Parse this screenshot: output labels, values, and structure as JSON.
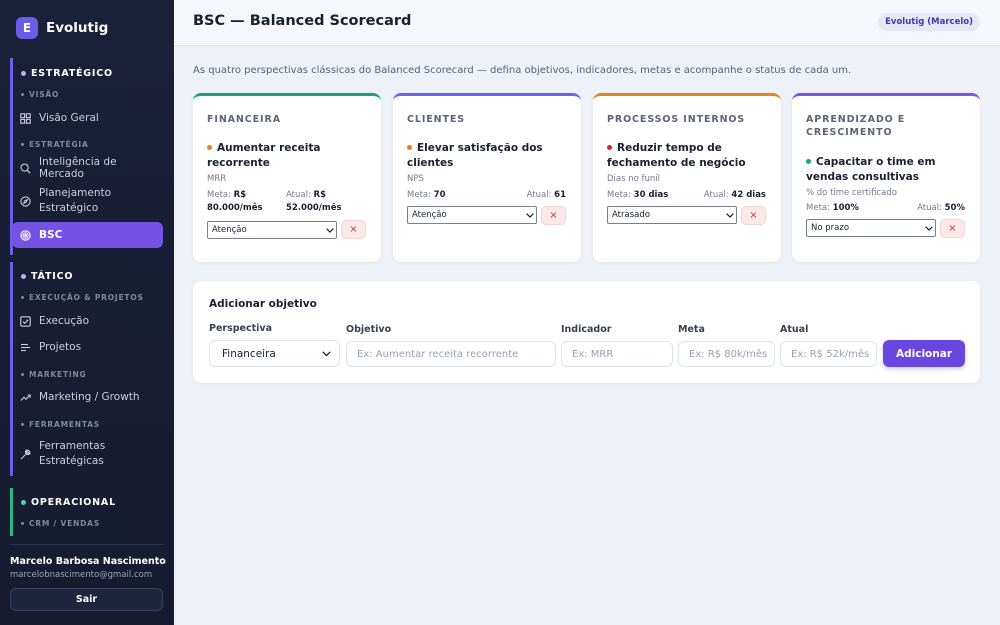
{
  "brand": {
    "logo_letter": "E",
    "name": "Evolutig"
  },
  "sidebar": {
    "sections": [
      {
        "label": "ESTRATÉGICO",
        "color": "#7c6cf0"
      },
      {
        "label": "TÁTICO",
        "color": "#7c6cf0"
      },
      {
        "label": "OPERACIONAL",
        "color": "#2bb57f"
      }
    ],
    "subs": [
      "VISÃO",
      "ESTRATÉGIA",
      "EXECUÇÃO & PROJETOS",
      "MARKETING",
      "FERRAMENTAS",
      "CRM / VENDAS"
    ],
    "items": [
      {
        "label": "Visão Geral",
        "icon": "grid-icon"
      },
      {
        "label": "Inteligência de Mercado",
        "icon": "search-icon"
      },
      {
        "label": "Planejamento Estratégico",
        "icon": "compass-icon"
      },
      {
        "label": "BSC",
        "icon": "target-icon",
        "active": true
      },
      {
        "label": "Execução",
        "icon": "checkbox-icon"
      },
      {
        "label": "Projetos",
        "icon": "list-icon"
      },
      {
        "label": "Marketing / Growth",
        "icon": "trend-icon"
      },
      {
        "label": "Ferramentas Estratégicas",
        "icon": "wrench-icon"
      }
    ],
    "user": {
      "name": "Marcelo Barbosa Nascimento",
      "email": "marcelobnascimento@gmail.com"
    },
    "logout_label": "Sair"
  },
  "header": {
    "title": "BSC — Balanced Scorecard",
    "user_badge": "Evolutig (Marcelo)"
  },
  "description": "As quatro perspectivas clássicas do Balanced Scorecard — defina objetivos, indicadores, metas e acompanhe o status de cada um.",
  "cards": [
    {
      "title": "FINANCEIRA",
      "color": "#1aa07a",
      "objective": "Aumentar receita recorrente",
      "dot": "#f07a1a",
      "indicator": "MRR",
      "meta_label": "Meta:",
      "meta": "R$ 80.000/mês",
      "atual_label": "Atual:",
      "atual": "R$ 52.000/mês",
      "status": "Atenção",
      "delete": "×"
    },
    {
      "title": "CLIENTES",
      "color": "#6d63f0",
      "objective": "Elevar satisfação dos clientes",
      "dot": "#f07a1a",
      "indicator": "NPS",
      "meta_label": "Meta:",
      "meta": "70",
      "atual_label": "Atual:",
      "atual": "61",
      "status": "Atenção",
      "delete": "×"
    },
    {
      "title": "PROCESSOS INTERNOS",
      "color": "#e0891a",
      "objective": "Reduzir tempo de fechamento de negócio",
      "dot": "#d9253a",
      "indicator": "Dias no funil",
      "meta_label": "Meta:",
      "meta": "30 dias",
      "atual_label": "Atual:",
      "atual": "42 dias",
      "status": "Atrasado",
      "delete": "×"
    },
    {
      "title": "APRENDIZADO E CRESCIMENTO",
      "color": "#7c55e8",
      "objective": "Capacitar o time em vendas consultivas",
      "dot": "#1aa07a",
      "indicator": "% do time certificado",
      "meta_label": "Meta:",
      "meta": "100%",
      "atual_label": "Atual:",
      "atual": "50%",
      "status": "No prazo",
      "delete": "×"
    }
  ],
  "form": {
    "title": "Adicionar objetivo",
    "labels": {
      "perspectiva": "Perspectiva",
      "objetivo": "Objetivo",
      "indicador": "Indicador",
      "meta": "Meta",
      "atual": "Atual"
    },
    "perspectiva_value": "Financeira",
    "placeholders": {
      "objetivo": "Ex: Aumentar receita recorrente",
      "indicador": "Ex: MRR",
      "meta": "Ex: R$ 80k/mês",
      "atual": "Ex: R$ 52k/mês"
    },
    "submit": "Adicionar"
  }
}
